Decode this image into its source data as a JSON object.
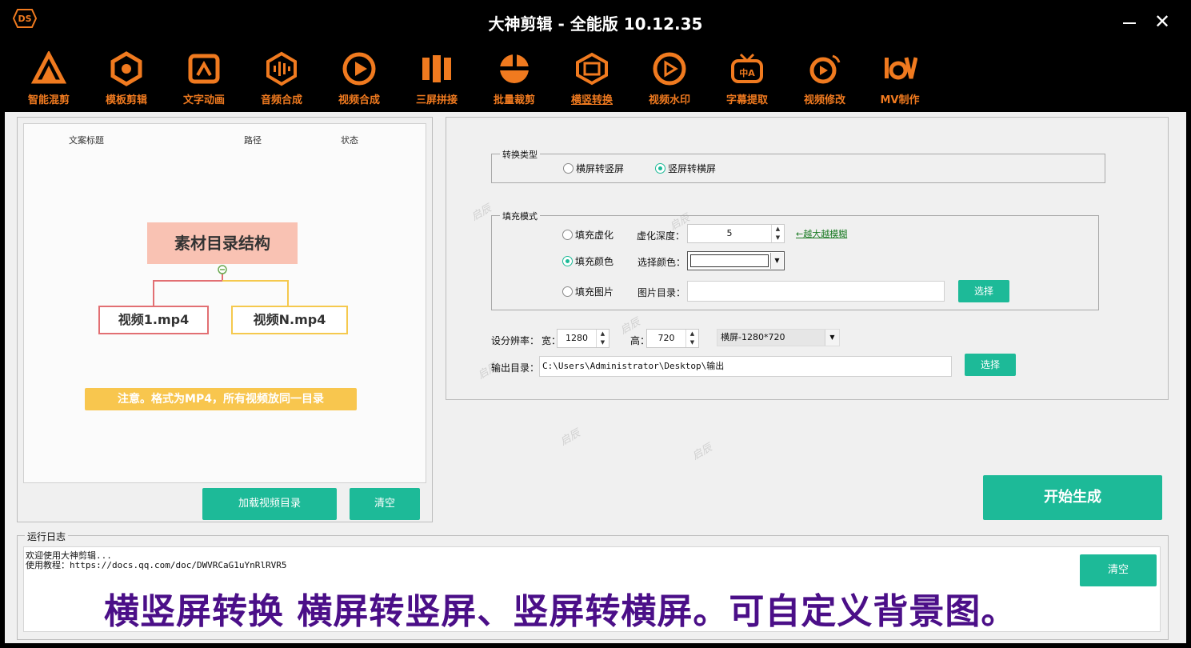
{
  "window": {
    "title": "大神剪辑 - 全能版 10.12.35",
    "minimize_label": "–",
    "close_label": "✕"
  },
  "toolbar": {
    "accent_color": "#f07a1f",
    "items": [
      {
        "label": "智能混剪",
        "icon": "smart-mix-icon"
      },
      {
        "label": "模板剪辑",
        "icon": "template-edit-icon"
      },
      {
        "label": "文字动画",
        "icon": "text-animation-icon"
      },
      {
        "label": "音频合成",
        "icon": "audio-merge-icon"
      },
      {
        "label": "视频合成",
        "icon": "video-merge-icon"
      },
      {
        "label": "三屏拼接",
        "icon": "triple-screen-icon"
      },
      {
        "label": "批量裁剪",
        "icon": "batch-crop-icon"
      },
      {
        "label": "横竖转换",
        "icon": "orientation-convert-icon",
        "active": true
      },
      {
        "label": "视频水印",
        "icon": "video-watermark-icon"
      },
      {
        "label": "字幕提取",
        "icon": "subtitle-extract-icon"
      },
      {
        "label": "视频修改",
        "icon": "video-modify-icon"
      },
      {
        "label": "MV制作",
        "icon": "mv-make-icon"
      }
    ]
  },
  "left_panel": {
    "columns": [
      "文案标题",
      "路径",
      "状态"
    ],
    "diagram": {
      "title": "素材目录结构",
      "file1": "视频1.mp4",
      "fileN": "视频N.mp4",
      "note": "注意。格式为MP4，所有视频放同一目录"
    },
    "load_button": "加载视频目录",
    "clear_button": "清空"
  },
  "convert_type": {
    "title": "转换类型",
    "options": [
      "横屏转竖屏",
      "竖屏转横屏"
    ],
    "selected": 1
  },
  "fill_mode": {
    "title": "填充模式",
    "blur_option": "填充虚化",
    "blur_depth_label": "虚化深度：",
    "blur_depth_value": "5",
    "blur_hint": "←越大越模糊",
    "color_option": "填充颜色",
    "color_label": "选择颜色：",
    "color_value": "#ffffff",
    "image_option": "填充图片",
    "image_dir_label": "图片目录：",
    "image_dir_value": "",
    "image_pick_button": "选择",
    "selected": "color"
  },
  "resolution": {
    "label": "设分辨率：",
    "width_label": "宽：",
    "width_value": "1280",
    "height_label": "高：",
    "height_value": "720",
    "preset": "横屏-1280*720"
  },
  "output": {
    "label": "输出目录：",
    "path": "C:\\Users\\Administrator\\Desktop\\输出",
    "pick_button": "选择"
  },
  "start_button": "开始生成",
  "log": {
    "title": "运行日志",
    "lines": [
      "欢迎使用大神剪辑...",
      "使用教程：https://docs.qq.com/doc/DWVRCaG1uYnRlRVR5"
    ],
    "clear_button": "清空",
    "caption": "横竖屏转换 横屏转竖屏、竖屏转横屏。可自定义背景图。"
  },
  "watermark_text": "启辰",
  "colors": {
    "teal": "#1dba98",
    "caption": "#4b0f88"
  }
}
